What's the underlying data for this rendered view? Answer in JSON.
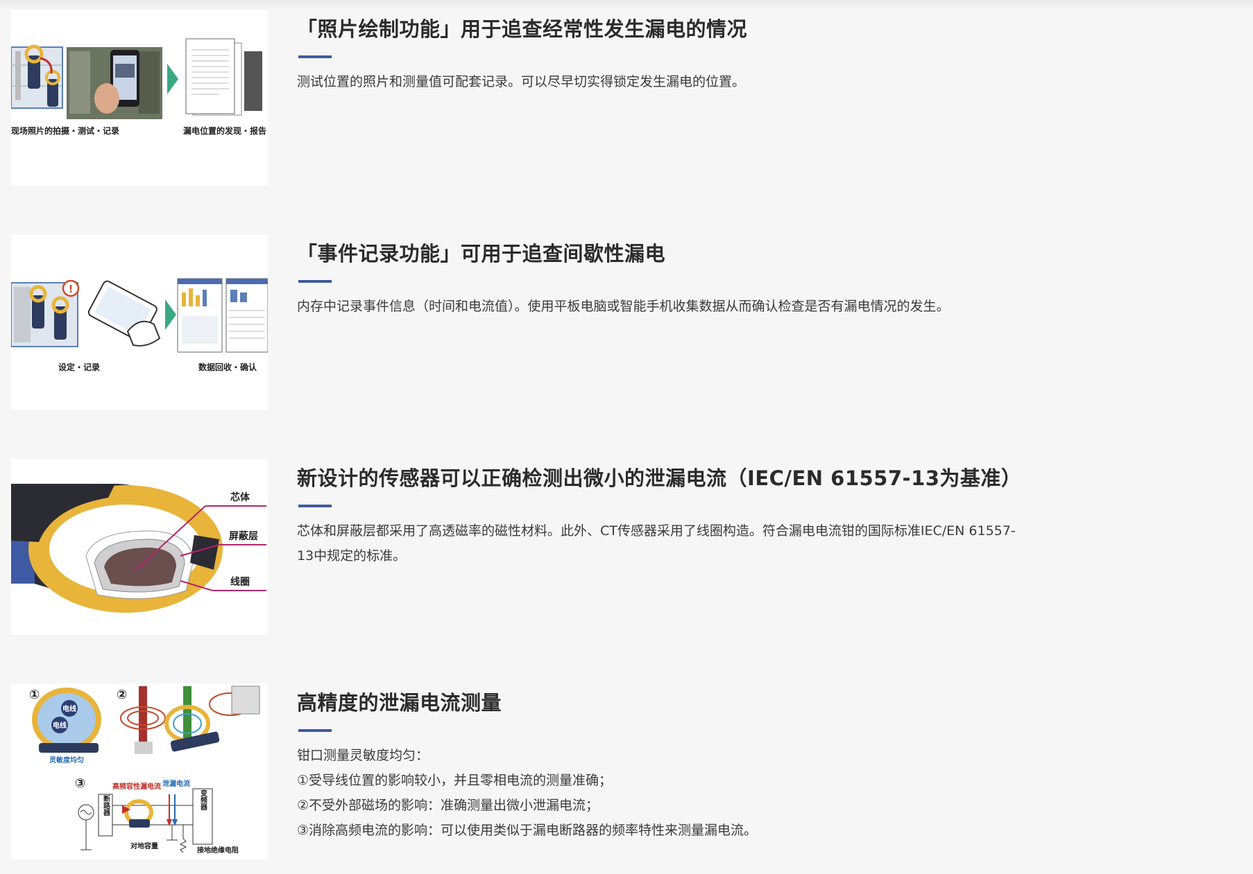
{
  "features": [
    {
      "title": "「照片绘制功能」用于追查经常性发生漏电的情况",
      "description": "测试位置的照片和测量值可配套记录。可以尽早切实得锁定发生漏电的位置。",
      "image": {
        "caption_left": "现场照片的拍摄・测试・记录",
        "caption_right": "漏电位置的发现・报告"
      }
    },
    {
      "title": "「事件记录功能」可用于追查间歇性漏电",
      "description": "内存中记录事件信息（时间和电流值）。使用平板电脑或智能手机收集数据从而确认检查是否有漏电情况的发生。",
      "image": {
        "caption_left": "设定・记录",
        "caption_right": "数据回收・确认"
      }
    },
    {
      "title": "新设计的传感器可以正确检测出微小的泄漏电流（IEC/EN 61557-13为基准）",
      "description": "芯体和屏蔽层都采用了高透磁率的磁性材料。此外、CT传感器采用了线圈构造。符合漏电电流钳的国际标准IEC/EN 61557-13中规定的标准。",
      "image": {
        "label_core": "芯体",
        "label_shield": "屏蔽层",
        "label_coil": "线圈"
      }
    },
    {
      "title": "高精度的泄漏电流测量",
      "lines": [
        "钳口测量灵敏度均匀：",
        "①受导线位置的影响较小，并且零相电流的测量准确；",
        "②不受外部磁场的影响：准确测量出微小泄漏电流；",
        "③消除高频电流的影响：可以使用类似于漏电断路器的频率特性来测量漏电流。"
      ],
      "image": {
        "num1": "①",
        "num2": "②",
        "num3": "③",
        "wire_label": "电线",
        "wire_label2": "电线",
        "uniform_label": "灵敏度均匀",
        "hf_label": "高频容性漏电流",
        "leak_label": "泄漏电流",
        "breaker_label": "断路器",
        "inverter_label": "变频器",
        "ground_cap_label": "对地容量",
        "ground_res_label": "接地绝缘电阻"
      }
    }
  ],
  "colors": {
    "accent_bar": "#3f5a9e",
    "title": "#2b2b2b",
    "text": "#3a3a3a",
    "background": "#f6f6f6",
    "clamp_yellow": "#e8b43a"
  }
}
